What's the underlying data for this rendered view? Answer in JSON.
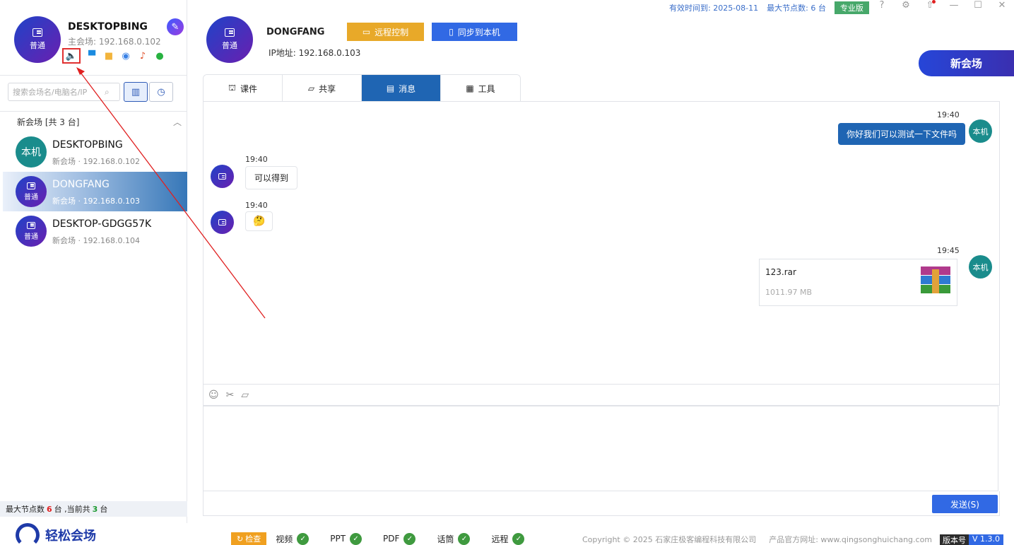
{
  "top": {
    "valid_until": "有效时间到: 2025-08-11",
    "max_nodes": "最大节点数: 6 台",
    "edition": "专业版"
  },
  "self": {
    "avatar_label": "普通",
    "name": "DESKTOPBING",
    "sub": "主会场: 192.168.0.102"
  },
  "search": {
    "placeholder": "搜索会场名/电脑名/IP"
  },
  "group": {
    "label": "新会场   [共 3 台]"
  },
  "nodes": [
    {
      "avatar": "本机",
      "name": "DESKTOPBING",
      "meta": "新会场 · 192.168.0.102"
    },
    {
      "avatar": "普通",
      "name": "DONGFANG",
      "meta": "新会场 · 192.168.0.103"
    },
    {
      "avatar": "普通",
      "name": "DESKTOP-GDGG57K",
      "meta": "新会场 · 192.168.0.104"
    }
  ],
  "footer_stat": {
    "prefix": "最大节点数",
    "max": "6",
    "mid": "台 ,当前共",
    "cur": "3",
    "suffix": "台"
  },
  "peer": {
    "avatar_label": "普通",
    "name": "DONGFANG",
    "ip": "IP地址: 192.168.0.103"
  },
  "buttons": {
    "remote": "远程控制",
    "sync": "同步到本机",
    "new_venue": "新会场",
    "send": "发送(S)"
  },
  "tabs": [
    {
      "label": "课件"
    },
    {
      "label": "共享"
    },
    {
      "label": "消息"
    },
    {
      "label": "工具"
    }
  ],
  "messages": [
    {
      "dir": "out",
      "time": "19:40",
      "text": "你好我们可以测试一下文件吗",
      "avatar": "本机"
    },
    {
      "dir": "in",
      "time": "19:40",
      "text": "可以得到"
    },
    {
      "dir": "in",
      "time": "19:40",
      "text": "🤔"
    },
    {
      "dir": "out",
      "time": "19:45",
      "file_name": "123.rar",
      "file_size": "1011.97 MB",
      "avatar": "本机"
    }
  ],
  "bottom": {
    "logo": "轻松会场",
    "check": "检查",
    "checks": [
      "视频",
      "PPT",
      "PDF",
      "话筒",
      "远程"
    ],
    "copyright": "Copyright © 2025 石家庄极客编程科技有限公司",
    "website": "产品官方网址: www.qingsonghuichang.com",
    "version_key": "版本号",
    "version_val": "V 1.3.0"
  },
  "colors": {
    "accent": "#1f65b3",
    "primary_button": "#3169e4",
    "remote_button": "#e8a929",
    "annotation": "#e02020"
  }
}
